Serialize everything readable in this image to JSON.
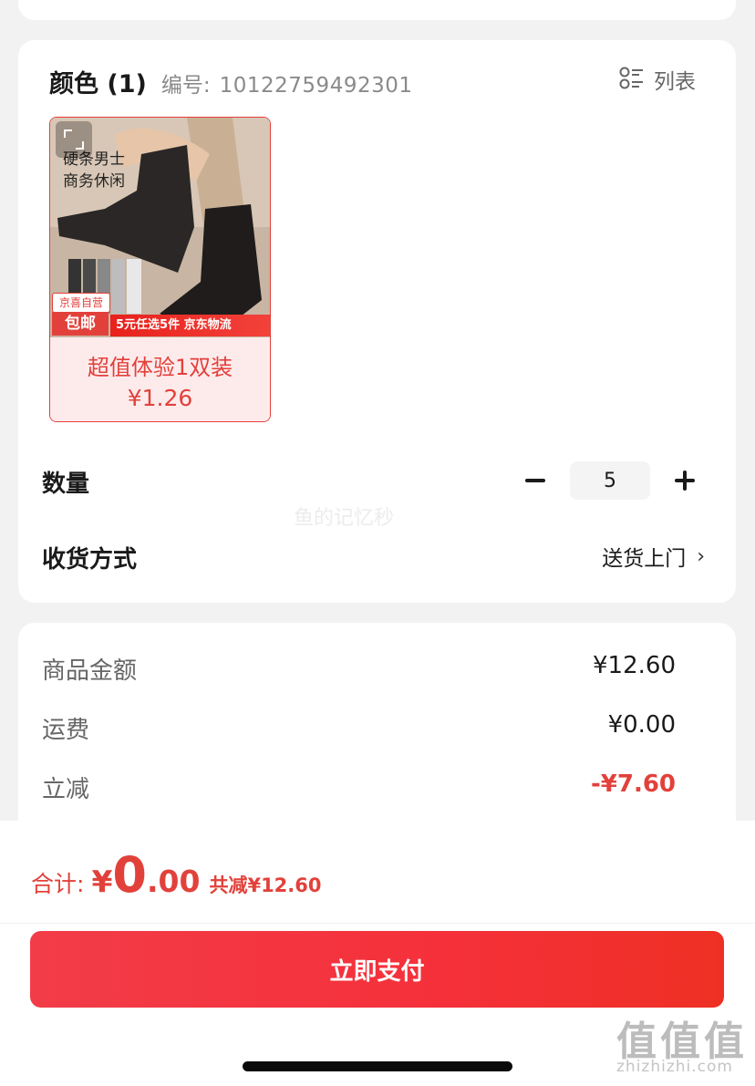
{
  "sku": {
    "title": "颜色 (1)",
    "number_label": "编号:",
    "number": "10122759492301",
    "list_toggle_label": "列表"
  },
  "product": {
    "photo_caption_line1": "硬条男士",
    "photo_caption_line2": "商务休闲",
    "badge_self_run": "京喜自营",
    "badge_free_shipping": "包邮",
    "promo_text": "5元任选5件 京东物流",
    "name": "超值体验1双装",
    "price": "¥1.26"
  },
  "quantity": {
    "label": "数量",
    "value": "5"
  },
  "delivery": {
    "label": "收货方式",
    "value": "送货上门",
    "chevron": "›"
  },
  "watermark": "鱼的记忆秒",
  "price_summary": {
    "rows": [
      {
        "label": "商品金额",
        "value": "¥12.60"
      },
      {
        "label": "运费",
        "value": "¥0.00"
      },
      {
        "label": "立减",
        "value": "-¥7.60"
      }
    ]
  },
  "footer": {
    "total_label": "合计:",
    "currency": "¥",
    "total_int": "0",
    "total_dec": ".00",
    "saved": "共减¥12.60",
    "pay_button": "立即支付"
  },
  "site_logo": {
    "glyphs": "值值值",
    "url": "zhizhizhi.com"
  },
  "colors": {
    "accent": "#e2413b",
    "pay_button": "#f23c48",
    "background": "#f2f2f2"
  },
  "icons": [
    "list-view-icon",
    "expand-icon",
    "minus-icon",
    "plus-icon",
    "chevron-right-icon"
  ]
}
